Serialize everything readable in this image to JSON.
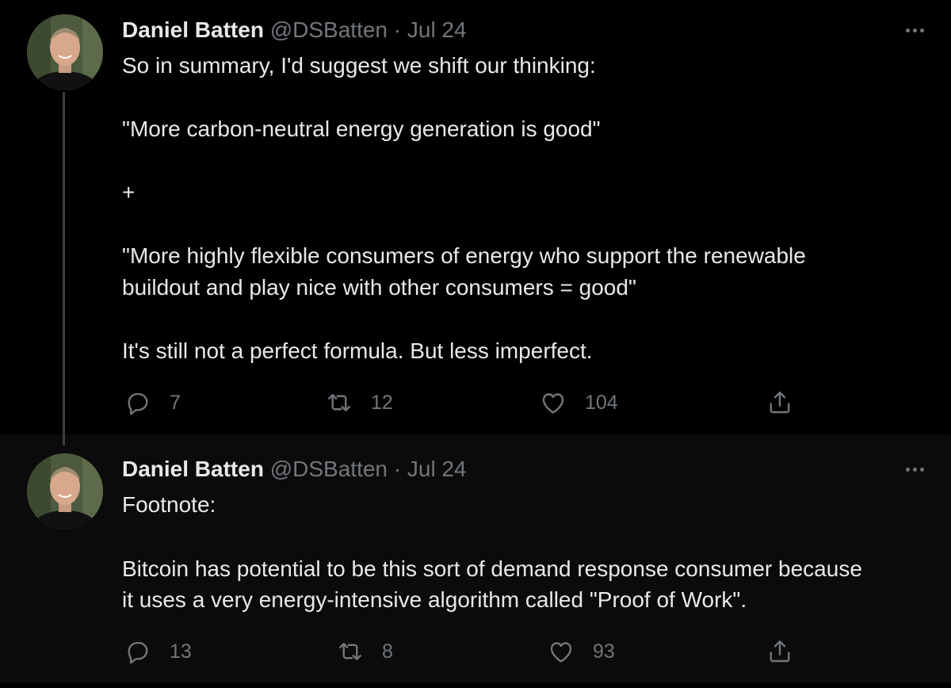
{
  "tweets": [
    {
      "author": {
        "name": "Daniel Batten",
        "handle": "@DSBatten",
        "separator": "·",
        "date": "Jul 24"
      },
      "lines": [
        "So in summary, I'd suggest we shift our thinking:",
        "\"More carbon-neutral energy generation is good\"",
        "+",
        "\"More highly flexible consumers of energy who support the renewable",
        "buildout and play nice with other consumers = good\"",
        "It's still not a perfect formula. But less imperfect."
      ],
      "actions": {
        "replies": "7",
        "retweets": "12",
        "likes": "104"
      }
    },
    {
      "author": {
        "name": "Daniel Batten",
        "handle": "@DSBatten",
        "separator": "·",
        "date": "Jul 24"
      },
      "lines": [
        "Footnote:",
        "Bitcoin has potential to be this sort of demand response consumer because",
        "it uses a very energy-intensive algorithm called \"Proof of Work\"."
      ],
      "actions": {
        "replies": "13",
        "retweets": "8",
        "likes": "93"
      }
    }
  ],
  "icons": {
    "reply": "speech-bubble",
    "retweet": "retweet-arrows",
    "like": "heart-outline",
    "share": "share-upload",
    "more": "ellipsis"
  },
  "colors": {
    "background": "#000000",
    "text": "#e7e9ea",
    "muted": "#71767b"
  }
}
